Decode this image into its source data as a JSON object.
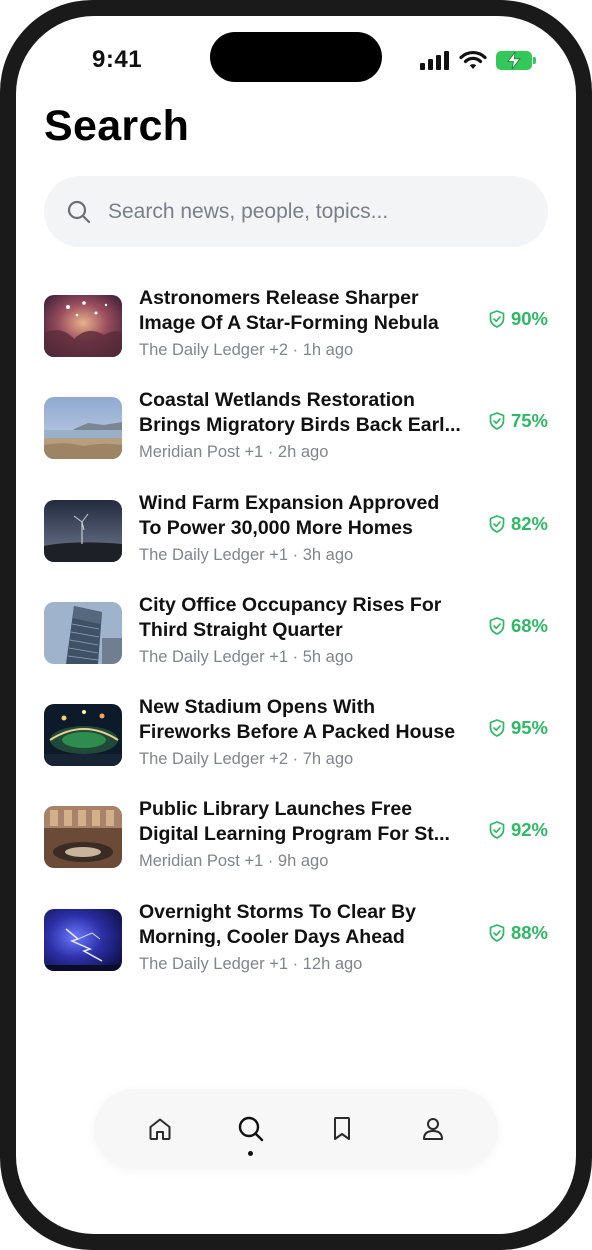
{
  "status_bar": {
    "time": "9:41"
  },
  "page": {
    "title": "Search"
  },
  "search": {
    "placeholder": "Search news, people, topics..."
  },
  "accent_color": "#2fb866",
  "results": [
    {
      "headline": "Astronomers Release Sharper\nImage Of A Star-Forming Nebula",
      "meta": "The Daily Ledger +2 · 1h ago",
      "score": "90%",
      "thumb_icon": "nebula-thumbnail"
    },
    {
      "headline": "Coastal Wetlands Restoration\nBrings Migratory Birds Back Earl...",
      "meta": "Meridian Post +1 · 2h ago",
      "score": "75%",
      "thumb_icon": "wetlands-thumbnail"
    },
    {
      "headline": "Wind Farm Expansion Approved\nTo Power 30,000 More Homes",
      "meta": "The Daily Ledger +1 · 3h ago",
      "score": "82%",
      "thumb_icon": "wind-farm-thumbnail"
    },
    {
      "headline": "City Office Occupancy Rises For\nThird Straight Quarter",
      "meta": "The Daily Ledger +1 · 5h ago",
      "score": "68%",
      "thumb_icon": "office-tower-thumbnail"
    },
    {
      "headline": "New Stadium Opens With\nFireworks Before A Packed House",
      "meta": "The Daily Ledger +2 · 7h ago",
      "score": "95%",
      "thumb_icon": "stadium-thumbnail"
    },
    {
      "headline": "Public Library Launches Free\nDigital Learning Program For St...",
      "meta": "Meridian Post +1 · 9h ago",
      "score": "92%",
      "thumb_icon": "library-thumbnail"
    },
    {
      "headline": "Overnight Storms To Clear By\nMorning, Cooler Days Ahead",
      "meta": "The Daily Ledger +1 · 12h ago",
      "score": "88%",
      "thumb_icon": "storm-thumbnail"
    }
  ],
  "tab_bar": {
    "tabs": [
      {
        "icon": "home-icon",
        "active": false
      },
      {
        "icon": "search-icon",
        "active": true
      },
      {
        "icon": "bookmark-icon",
        "active": false
      },
      {
        "icon": "profile-icon",
        "active": false
      }
    ]
  }
}
